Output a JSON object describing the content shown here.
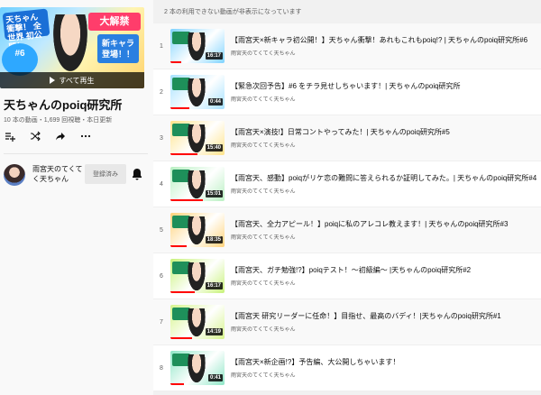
{
  "sidebar": {
    "hero": {
      "badge_left": "天ちゃん衝撃！ 全世界 初公開！",
      "badge_right_top": "大解禁",
      "badge_right": "新キャラ 登場！！",
      "badge_number": "#6",
      "play_all": "すべて再生"
    },
    "playlist_title": "天ちゃんのpoiq研究所",
    "playlist_meta": "10 本の動画・1,699 回視聴・本日更新",
    "owner": {
      "name": "雨宮天のてくてく天ちゃん",
      "subscribe_label": "登録済み"
    }
  },
  "notice": "2 本の利用できない動画が非表示になっています",
  "videos": [
    {
      "index": "1",
      "title": "【雨宮天×新キャラ初公開！】天ちゃん衝撃！あれもこれもpoiq!? | 天ちゃんのpoiq研究所#6",
      "channel": "雨宮天のてくてく天ちゃん",
      "duration": "16:17",
      "progress": 0.2,
      "color": "#7fd3ff"
    },
    {
      "index": "2",
      "title": "【緊急次回予告】#6 をチラ見せしちゃいます！| 天ちゃんのpoiq研究所",
      "channel": "雨宮天のてくてく天ちゃん",
      "duration": "0:44",
      "progress": 0.35,
      "color": "#a6e1ff"
    },
    {
      "index": "3",
      "title": "【雨宮天×演技!】日常コントやってみた！| 天ちゃんのpoiq研究所#5",
      "channel": "雨宮天のてくてく天ちゃん",
      "duration": "15:40",
      "progress": 0.5,
      "color": "#ffe38a"
    },
    {
      "index": "4",
      "title": "【雨宮天、感動】poiqがリケ恋の難問に答えられるか証明してみた。| 天ちゃんのpoiq研究所#4",
      "channel": "雨宮天のてくてく天ちゃん",
      "duration": "15:01",
      "progress": 0.6,
      "color": "#b9f0c2"
    },
    {
      "index": "5",
      "title": "【雨宮天、全力アピール！】poiqに私のアレコレ教えます！| 天ちゃんのpoiq研究所#3",
      "channel": "雨宮天のてくてく天ちゃん",
      "duration": "18:35",
      "progress": 0.3,
      "color": "#ffd27a"
    },
    {
      "index": "6",
      "title": "【雨宮天、ガチ勉強!?】poiqテスト！～初級編～ |天ちゃんのpoiq研究所#2",
      "channel": "雨宮天のてくてく天ちゃん",
      "duration": "16:17",
      "progress": 0.45,
      "color": "#c8f27a"
    },
    {
      "index": "7",
      "title": "【雨宮天 研究リーダーに任命！】目指せ、最高のバディ！|天ちゃんのpoiq研究所#1",
      "channel": "雨宮天のてくてく天ちゃん",
      "duration": "14:19",
      "progress": 0.4,
      "color": "#d6f48c"
    },
    {
      "index": "8",
      "title": "【雨宮天×新企画!?】予告編、大公開しちゃいます！",
      "channel": "雨宮天のてくてく天ちゃん",
      "duration": "0:41",
      "progress": 0.25,
      "color": "#8ee6c6"
    }
  ]
}
